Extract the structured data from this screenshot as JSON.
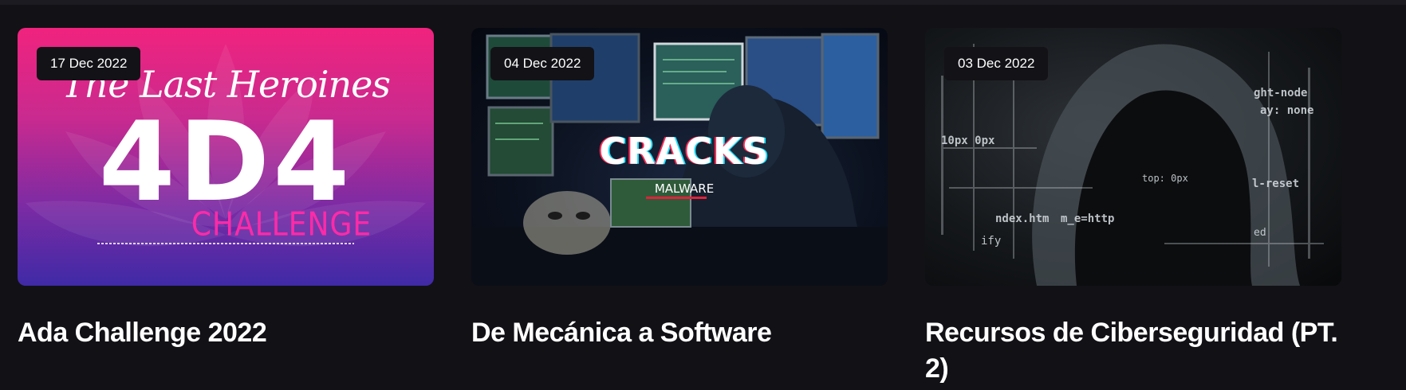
{
  "posts": [
    {
      "date": "17 Dec 2022",
      "title": "Ada Challenge 2022",
      "thumbnail": {
        "tagline": "The Last Heroines",
        "big_text": "4D4",
        "sub_text": "CHALLENGE"
      }
    },
    {
      "date": "04 Dec 2022",
      "title": "De Mecánica a Software",
      "thumbnail": {
        "big_text": "CRACKS",
        "sub_text": "MALWARE"
      }
    },
    {
      "date": "03 Dec 2022",
      "title": "Recursos de Ciberseguridad (PT. 2)",
      "thumbnail": {
        "code_lines": [
          "ght-node",
          "ay: none",
          "10px 0px",
          "top: 0px",
          "l-reset",
          "ndex.htm",
          "m_e=http",
          "ify",
          "ed"
        ]
      }
    }
  ],
  "colors": {
    "background": "#121116",
    "badge_bg": "#131217",
    "title_text": "#ffffff",
    "ada_pink": "#f0237e",
    "ada_purple": "#3f2aa6",
    "challenge_pink": "#ff2aa8",
    "malware_red": "#e3213a"
  }
}
